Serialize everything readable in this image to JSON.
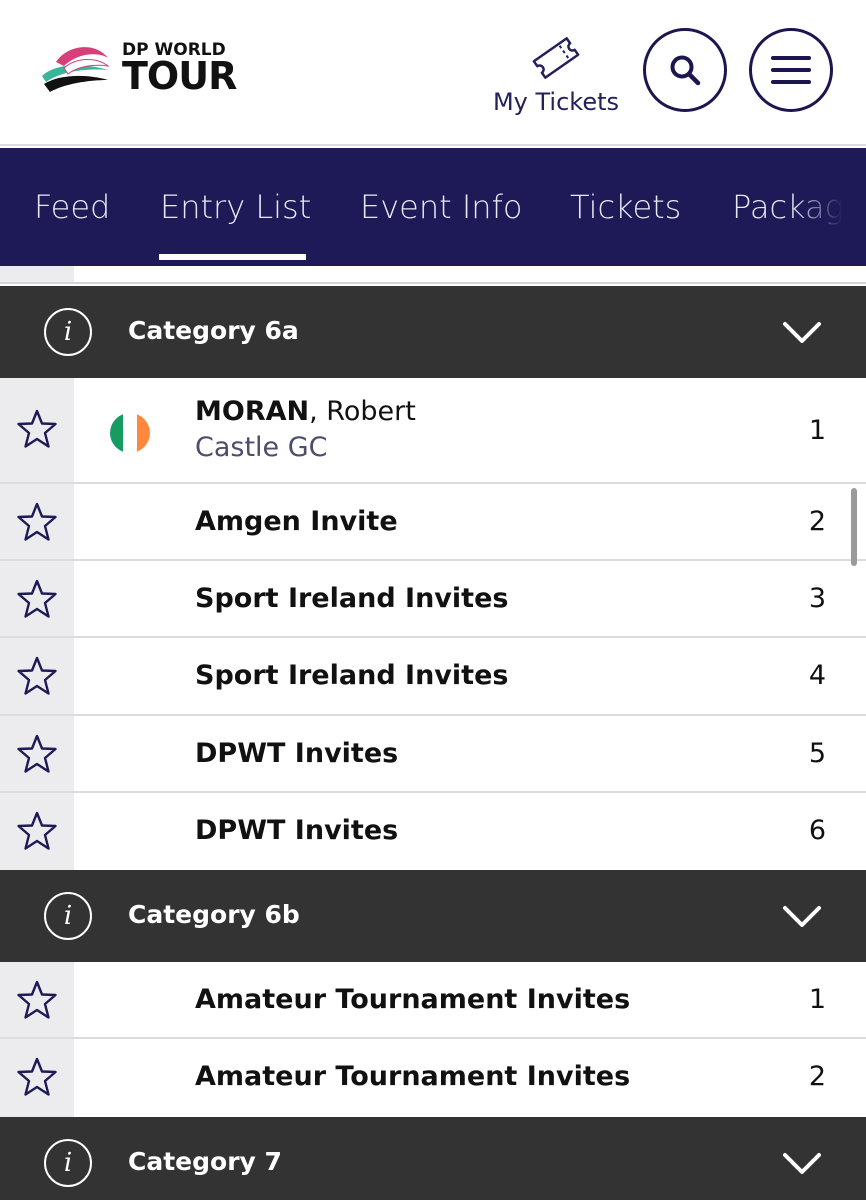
{
  "header": {
    "logo": {
      "line1": "DP WORLD",
      "line2": "TOUR"
    },
    "my_tickets_label": "My Tickets",
    "icons": {
      "ticket": "ticket-icon",
      "search": "search-icon",
      "menu": "menu-icon"
    }
  },
  "tabs": [
    {
      "label": "Feed",
      "active": false
    },
    {
      "label": "Entry List",
      "active": true
    },
    {
      "label": "Event Info",
      "active": false
    },
    {
      "label": "Tickets",
      "active": false
    },
    {
      "label": "Packages",
      "active": false
    }
  ],
  "categories": [
    {
      "title": "Category 6a",
      "rows": [
        {
          "surname": "MORAN",
          "first_name": ", Robert",
          "club": "Castle GC",
          "flag": "ireland",
          "position": "1"
        },
        {
          "name": "Amgen Invite",
          "position": "2"
        },
        {
          "name": "Sport Ireland Invites",
          "position": "3"
        },
        {
          "name": "Sport Ireland Invites",
          "position": "4"
        },
        {
          "name": "DPWT Invites",
          "position": "5"
        },
        {
          "name": "DPWT Invites",
          "position": "6"
        }
      ]
    },
    {
      "title": "Category 6b",
      "rows": [
        {
          "name": "Amateur Tournament Invites",
          "position": "1"
        },
        {
          "name": "Amateur Tournament Invites",
          "position": "2"
        }
      ]
    },
    {
      "title": "Category 7",
      "rows": []
    }
  ],
  "colors": {
    "nav_background": "#1d1a57",
    "category_background": "#333333",
    "flag_green": "#169b62",
    "flag_white": "#ffffff",
    "flag_orange": "#ff883e"
  }
}
